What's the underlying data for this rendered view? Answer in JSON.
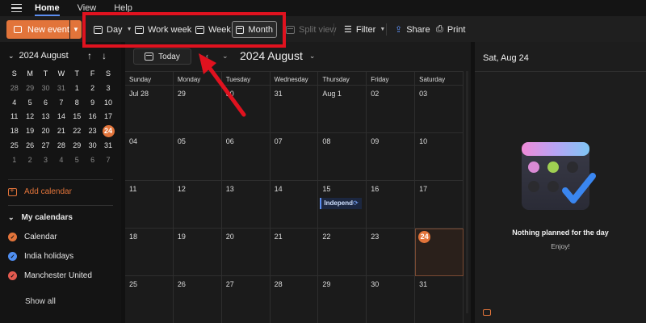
{
  "menu": {
    "tabs": [
      {
        "label": "Home"
      },
      {
        "label": "View"
      },
      {
        "label": "Help"
      }
    ]
  },
  "ribbon": {
    "new_event": "New event",
    "day": "Day",
    "work_week": "Work week",
    "week": "Week",
    "month": "Month",
    "split_view": "Split view",
    "filter": "Filter",
    "share": "Share",
    "print": "Print"
  },
  "mini_calendar": {
    "title": "2024 August",
    "weekdays": [
      "S",
      "M",
      "T",
      "W",
      "T",
      "F",
      "S"
    ],
    "weeks": [
      [
        "28",
        "29",
        "30",
        "31",
        "1",
        "2",
        "3"
      ],
      [
        "4",
        "5",
        "6",
        "7",
        "8",
        "9",
        "10"
      ],
      [
        "11",
        "12",
        "13",
        "14",
        "15",
        "16",
        "17"
      ],
      [
        "18",
        "19",
        "20",
        "21",
        "22",
        "23",
        "24"
      ],
      [
        "25",
        "26",
        "27",
        "28",
        "29",
        "30",
        "31"
      ],
      [
        "1",
        "2",
        "3",
        "4",
        "5",
        "6",
        "7"
      ]
    ],
    "today": "24"
  },
  "sidebar": {
    "add_calendar": "Add calendar",
    "my_calendars": "My calendars",
    "calendars": [
      {
        "name": "Calendar",
        "color": "#e2743a"
      },
      {
        "name": "India holidays",
        "color": "#4f8ef0"
      },
      {
        "name": "Manchester United",
        "color": "#e25a4f"
      }
    ],
    "show_all": "Show all"
  },
  "main": {
    "today_button": "Today",
    "month_title": "2024 August",
    "weekday_headers": [
      "Sunday",
      "Monday",
      "Tuesday",
      "Wednesday",
      "Thursday",
      "Friday",
      "Saturday"
    ],
    "weeks": [
      [
        "Jul 28",
        "29",
        "30",
        "31",
        "Aug 1",
        "02",
        "03"
      ],
      [
        "04",
        "05",
        "06",
        "07",
        "08",
        "09",
        "10"
      ],
      [
        "11",
        "12",
        "13",
        "14",
        "15",
        "16",
        "17"
      ],
      [
        "18",
        "19",
        "20",
        "21",
        "22",
        "23",
        "24"
      ],
      [
        "25",
        "26",
        "27",
        "28",
        "29",
        "30",
        "31"
      ]
    ],
    "selected_day": "24",
    "event": {
      "day": "15",
      "label": "Independ"
    }
  },
  "right_pane": {
    "date": "Sat, Aug 24",
    "empty_title": "Nothing planned for the day",
    "empty_subtitle": "Enjoy!"
  },
  "colors": {
    "accent": "#e2743a",
    "highlight_box": "#e0121f",
    "arrow": "#e0121f"
  }
}
